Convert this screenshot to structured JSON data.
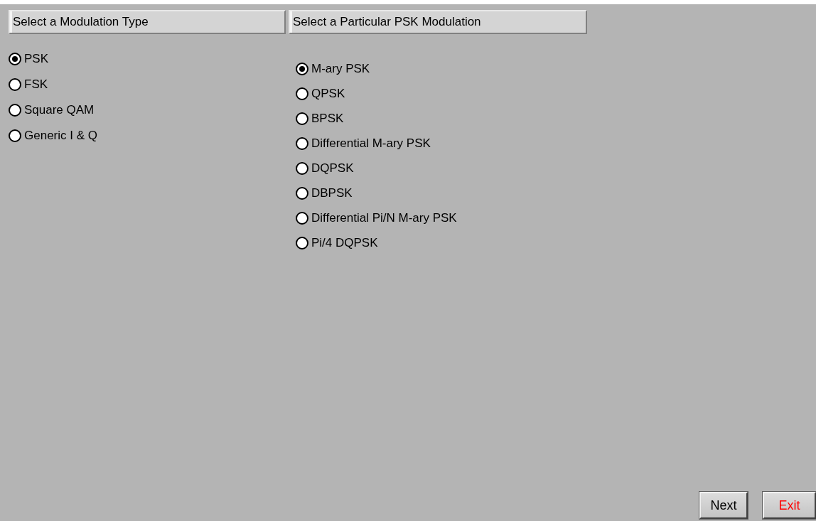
{
  "groups": [
    {
      "header": "Select a Modulation Type",
      "options": [
        {
          "label": "PSK",
          "selected": true
        },
        {
          "label": "FSK",
          "selected": false
        },
        {
          "label": "Square QAM",
          "selected": false
        },
        {
          "label": "Generic I & Q",
          "selected": false
        }
      ]
    },
    {
      "header": "Select a Particular PSK Modulation",
      "options": [
        {
          "label": "M-ary PSK",
          "selected": true
        },
        {
          "label": "QPSK",
          "selected": false
        },
        {
          "label": "BPSK",
          "selected": false
        },
        {
          "label": "Differential M-ary PSK",
          "selected": false
        },
        {
          "label": "DQPSK",
          "selected": false
        },
        {
          "label": "DBPSK",
          "selected": false
        },
        {
          "label": "Differential Pi/N M-ary PSK",
          "selected": false
        },
        {
          "label": "Pi/4 DQPSK",
          "selected": false
        }
      ]
    }
  ],
  "buttons": [
    {
      "label": "Next",
      "kind": "normal"
    },
    {
      "label": "Exit",
      "kind": "danger"
    }
  ]
}
